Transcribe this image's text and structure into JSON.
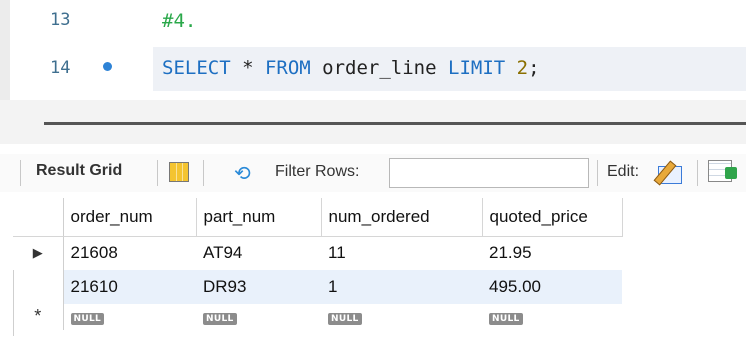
{
  "editor": {
    "lines": [
      {
        "number": "13",
        "code_comment": "#4."
      },
      {
        "number": "14",
        "tokens": [
          {
            "text": "SELECT",
            "kind": "keyword"
          },
          {
            "text": " * ",
            "kind": "text"
          },
          {
            "text": "FROM",
            "kind": "keyword"
          },
          {
            "text": " order_line ",
            "kind": "text"
          },
          {
            "text": "LIMIT",
            "kind": "keyword"
          },
          {
            "text": " 2",
            "kind": "number"
          },
          {
            "text": ";",
            "kind": "text"
          }
        ]
      }
    ]
  },
  "toolbar": {
    "result_grid_label": "Result Grid",
    "filter_rows_label": "Filter Rows:",
    "filter_value": "",
    "edit_label": "Edit:"
  },
  "grid": {
    "columns": [
      "order_num",
      "part_num",
      "num_ordered",
      "quoted_price"
    ],
    "rows": [
      [
        "21608",
        "AT94",
        "11",
        "21.95"
      ],
      [
        "21610",
        "DR93",
        "1",
        "495.00"
      ]
    ],
    "null_label": "NULL",
    "current_row_marker": "▶",
    "new_row_marker": "*"
  },
  "colors": {
    "keyword": "#1d6fc2",
    "comment": "#2aa84a",
    "number": "#8a6f00",
    "selected_row": "#e9f1fb"
  },
  "icons": [
    "breakpoint-dot-icon",
    "grid-layout-icon",
    "refresh-icon",
    "edit-pencil-icon",
    "add-row-icon"
  ]
}
